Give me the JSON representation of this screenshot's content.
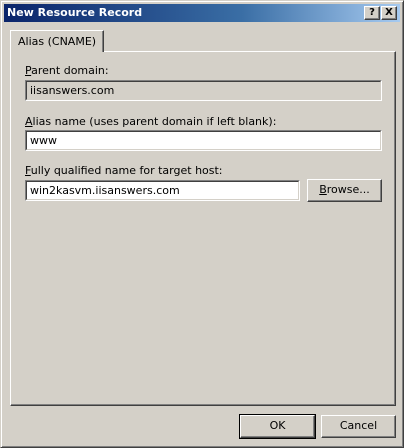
{
  "window": {
    "title": "New Resource Record"
  },
  "titlebar": {
    "help_glyph": "?",
    "close_glyph": "X"
  },
  "tab": {
    "label": "Alias (CNAME)"
  },
  "parent_domain": {
    "label_u": "P",
    "label_rest": "arent domain:",
    "value": "iisanswers.com"
  },
  "alias_name": {
    "label_u": "A",
    "label_rest": "lias name (uses parent domain if left blank):",
    "value": "www"
  },
  "fqdn": {
    "label_u": "F",
    "label_rest": "ully qualified name for target host:",
    "value": "win2kasvm.iisanswers.com"
  },
  "buttons": {
    "browse_u": "B",
    "browse_rest": "rowse...",
    "ok": "OK",
    "cancel": "Cancel"
  }
}
